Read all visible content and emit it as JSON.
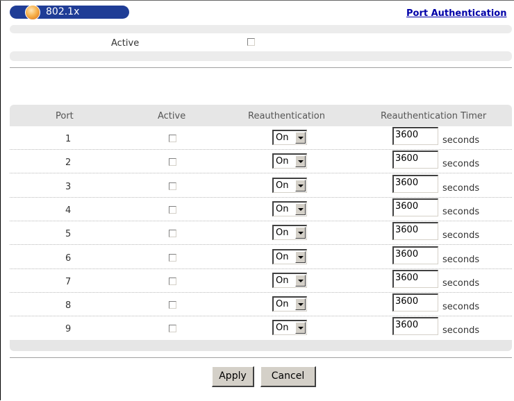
{
  "header": {
    "title": "802.1x",
    "link": "Port Authentication"
  },
  "global": {
    "active_label": "Active",
    "active_checked": false
  },
  "table": {
    "headers": [
      "Port",
      "Active",
      "Reauthentication",
      "Reauthentication Timer"
    ],
    "rows": [
      {
        "port": "1",
        "active": false,
        "reauth": "On",
        "timer": "3600",
        "unit": "seconds"
      },
      {
        "port": "2",
        "active": false,
        "reauth": "On",
        "timer": "3600",
        "unit": "seconds"
      },
      {
        "port": "3",
        "active": false,
        "reauth": "On",
        "timer": "3600",
        "unit": "seconds"
      },
      {
        "port": "4",
        "active": false,
        "reauth": "On",
        "timer": "3600",
        "unit": "seconds"
      },
      {
        "port": "5",
        "active": false,
        "reauth": "On",
        "timer": "3600",
        "unit": "seconds"
      },
      {
        "port": "6",
        "active": false,
        "reauth": "On",
        "timer": "3600",
        "unit": "seconds"
      },
      {
        "port": "7",
        "active": false,
        "reauth": "On",
        "timer": "3600",
        "unit": "seconds"
      },
      {
        "port": "8",
        "active": false,
        "reauth": "On",
        "timer": "3600",
        "unit": "seconds"
      },
      {
        "port": "9",
        "active": false,
        "reauth": "On",
        "timer": "3600",
        "unit": "seconds"
      }
    ]
  },
  "buttons": {
    "apply": "Apply",
    "cancel": "Cancel"
  },
  "colors": {
    "title_pill": "#1f3d96",
    "link": "#0000a8",
    "band": "#e6e6e6"
  }
}
